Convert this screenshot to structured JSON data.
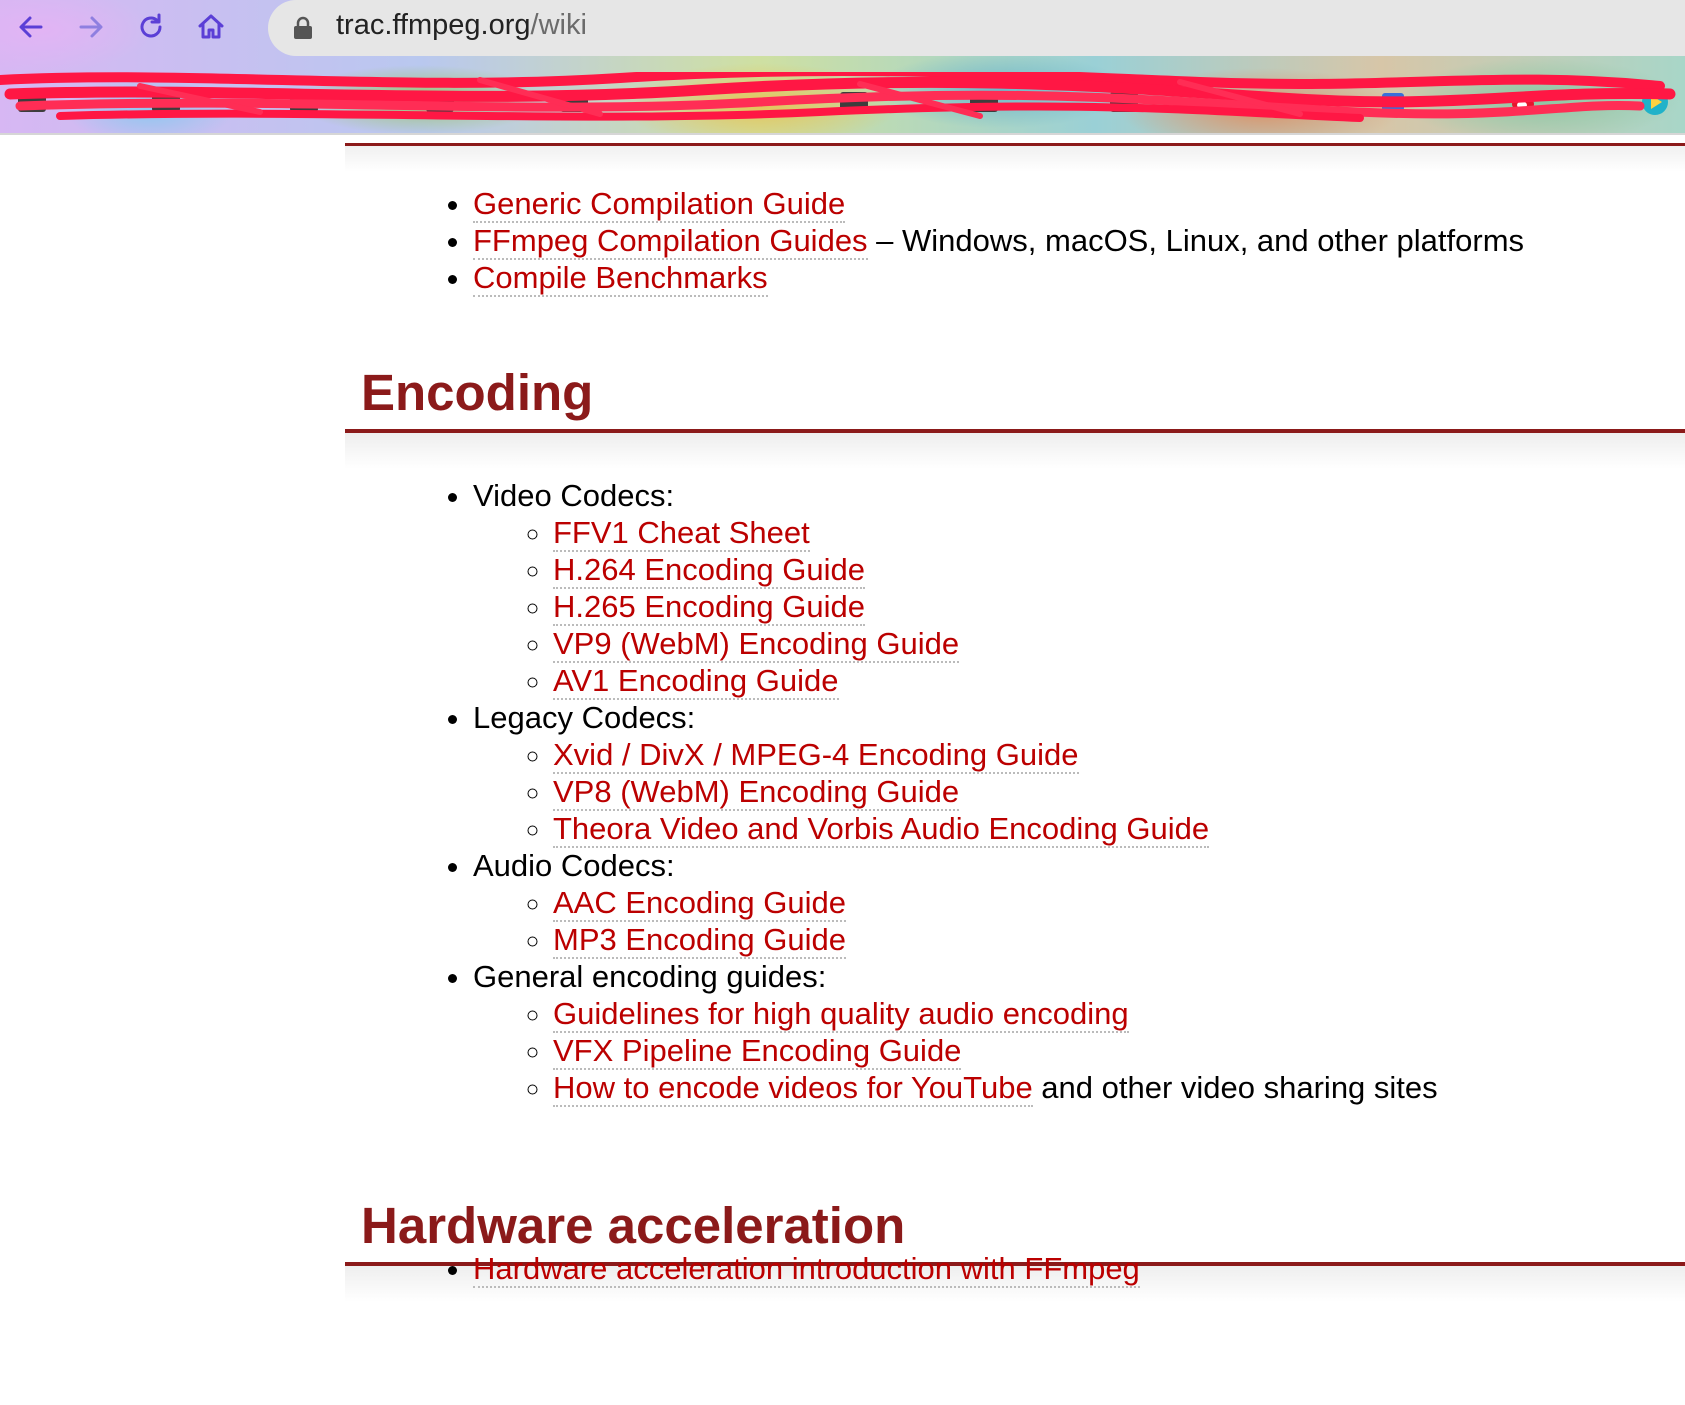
{
  "browser": {
    "back_icon": "arrow-left-icon",
    "forward_icon": "arrow-right-icon",
    "reload_icon": "reload-icon",
    "home_icon": "home-icon",
    "lock_icon": "lock-icon",
    "url_host": "trac.ffmpeg.org",
    "url_path": "/wiki",
    "accent_color": "#5b3fd6",
    "bookmarks_redacted": true
  },
  "compiling": {
    "items": [
      {
        "link": "Generic Compilation Guide",
        "suffix": ""
      },
      {
        "link": "FFmpeg Compilation Guides",
        "suffix": " – Windows, macOS, Linux, and other platforms"
      },
      {
        "link": "Compile Benchmarks",
        "suffix": ""
      }
    ]
  },
  "encoding": {
    "title": "Encoding",
    "groups": [
      {
        "label": "Video Codecs:",
        "links": [
          "FFV1 Cheat Sheet",
          "H.264 Encoding Guide",
          "H.265 Encoding Guide",
          "VP9 (WebM) Encoding Guide",
          "AV1 Encoding Guide"
        ]
      },
      {
        "label": "Legacy Codecs:",
        "links": [
          "Xvid / DivX / MPEG-4 Encoding Guide",
          "VP8 (WebM) Encoding Guide",
          "Theora Video and Vorbis Audio Encoding Guide"
        ]
      },
      {
        "label": "Audio Codecs:",
        "links": [
          "AAC Encoding Guide",
          "MP3 Encoding Guide"
        ]
      },
      {
        "label": "General encoding guides:",
        "links": [
          "Guidelines for high quality audio encoding",
          "VFX Pipeline Encoding Guide",
          "How to encode videos for YouTube"
        ],
        "last_suffix": " and other video sharing sites"
      }
    ]
  },
  "hardware": {
    "title": "Hardware acceleration",
    "items": [
      {
        "link": "Hardware acceleration introduction with FFmpeg"
      }
    ]
  },
  "colors": {
    "heading": "#8b1a1a",
    "link": "#bb0000"
  }
}
